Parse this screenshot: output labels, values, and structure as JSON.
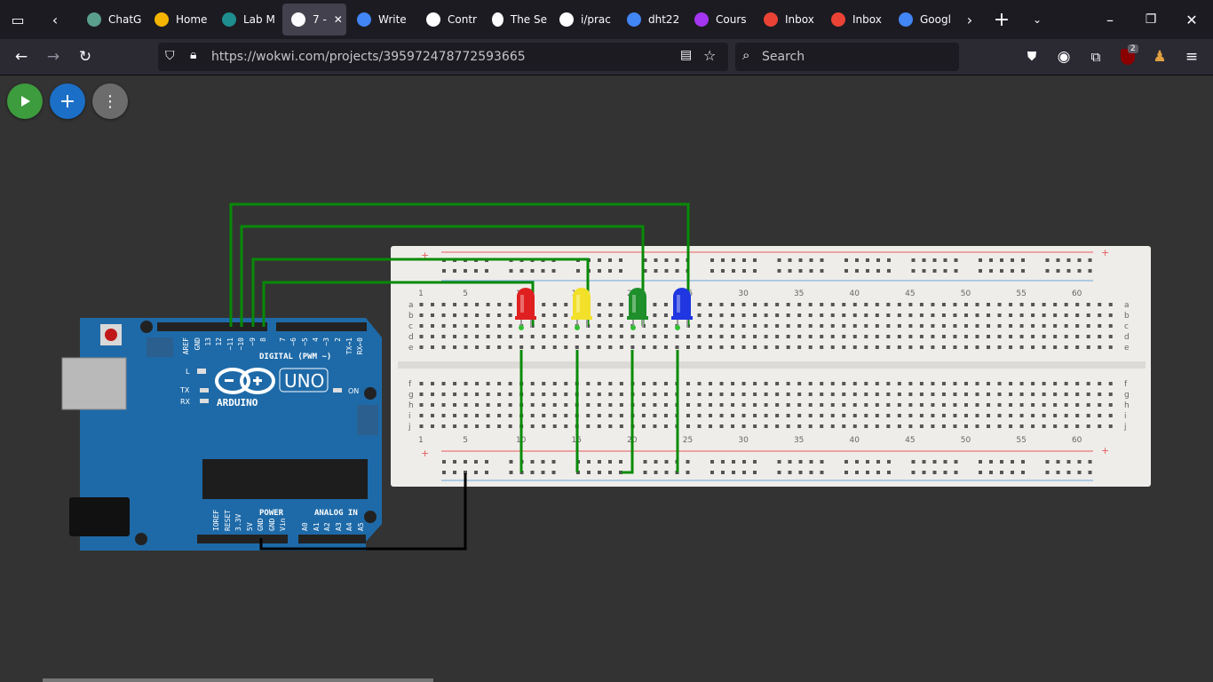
{
  "tabs": [
    {
      "title": "ChatG",
      "icon": "chatgpt-icon",
      "color": "#5a9e8c"
    },
    {
      "title": "Home",
      "icon": "classroom-icon",
      "color": "#f4b400"
    },
    {
      "title": "Lab M",
      "icon": "classroom-icon",
      "color": "#1e8e8e"
    },
    {
      "title": "7 -",
      "icon": "wokwi-icon",
      "color": "#fbfbfe",
      "active": true
    },
    {
      "title": "Write",
      "icon": "google-icon",
      "color": "#4285f4"
    },
    {
      "title": "Contr",
      "icon": "medium-icon",
      "color": "#ffffff"
    },
    {
      "title": "The Se",
      "icon": "wokwi-icon",
      "color": "#fbfbfe"
    },
    {
      "title": "i/prac",
      "icon": "github-icon",
      "color": "#ffffff"
    },
    {
      "title": "dht22",
      "icon": "google-icon",
      "color": "#4285f4"
    },
    {
      "title": "Cours",
      "icon": "udemy-icon",
      "color": "#a435f0"
    },
    {
      "title": "Inbox",
      "icon": "gmail-icon",
      "color": "#ea4335"
    },
    {
      "title": "Inbox",
      "icon": "gmail-icon",
      "color": "#ea4335"
    },
    {
      "title": "Googl",
      "icon": "google-icon",
      "color": "#4285f4"
    }
  ],
  "url": "https://wokwi.com/projects/395972478772593665",
  "search_placeholder": "Search",
  "extension_badge": "2",
  "colors": {
    "play": "#3d9c3d",
    "add": "#1b6fc7",
    "menu": "#6c6c6c",
    "board": "#1e6aa8",
    "wire_green": "#078a07",
    "wire_black": "#000000",
    "breadboard": "#efedea"
  },
  "board": {
    "uno": "UNO",
    "brand": "ARDUINO",
    "digital_header": "DIGITAL (PWM ~)",
    "power_header": "POWER",
    "analog_header": "ANALOG IN",
    "on": "ON",
    "l": "L",
    "tx": "TX",
    "rx": "RX",
    "top_pins": [
      "AREF",
      "GND",
      "13",
      "12",
      "~11",
      "~10",
      "~9",
      "8",
      "7",
      "~6",
      "~5",
      "4",
      "~3",
      "2",
      "TX→1",
      "RX←0"
    ],
    "power_pins": [
      "IOREF",
      "RESET",
      "3.3V",
      "5V",
      "GND",
      "GND",
      "Vin"
    ],
    "analog_pins": [
      "A0",
      "A1",
      "A2",
      "A3",
      "A4",
      "A5"
    ]
  },
  "breadboard": {
    "col_labels": [
      "1",
      "5",
      "10",
      "15",
      "20",
      "25",
      "30",
      "35",
      "40",
      "45",
      "50",
      "55",
      "60"
    ],
    "rows_top": [
      "a",
      "b",
      "c",
      "d",
      "e"
    ],
    "rows_bottom": [
      "f",
      "g",
      "h",
      "i",
      "j"
    ],
    "plus": "+"
  },
  "leds": [
    {
      "color": "#e02020",
      "name": "red-led"
    },
    {
      "color": "#f2e02a",
      "name": "yellow-led"
    },
    {
      "color": "#1e8f2a",
      "name": "green-led"
    },
    {
      "color": "#1f36e0",
      "name": "blue-led"
    }
  ]
}
